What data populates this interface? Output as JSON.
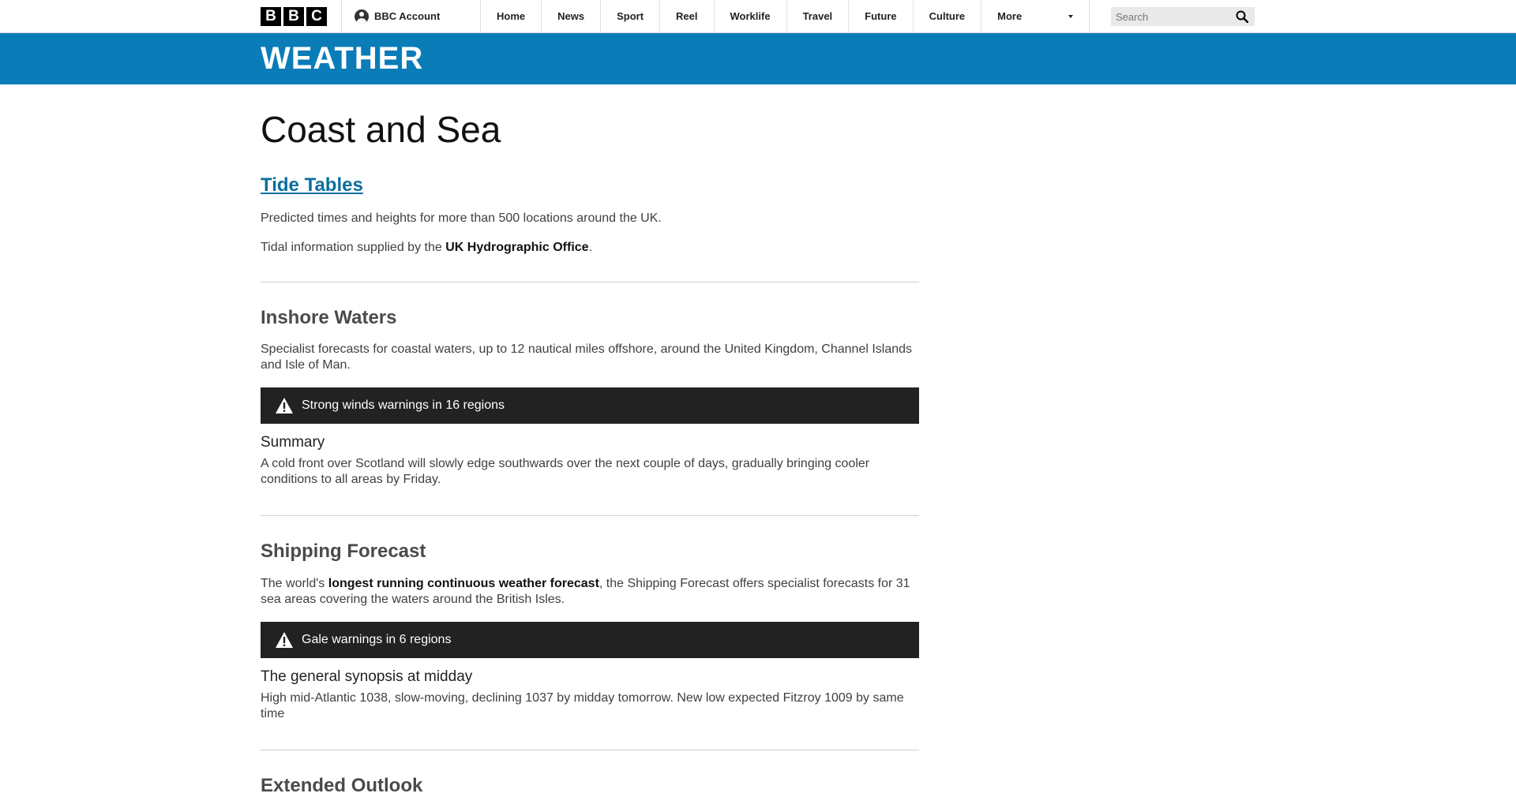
{
  "header": {
    "logo_letters": [
      "B",
      "B",
      "C"
    ],
    "account_label": "BBC Account",
    "nav": [
      "Home",
      "News",
      "Sport",
      "Reel",
      "Worklife",
      "Travel",
      "Future",
      "Culture"
    ],
    "more_label": "More",
    "search_placeholder": "Search"
  },
  "band": {
    "title": "WEATHER"
  },
  "page": {
    "title": "Coast and Sea"
  },
  "tide": {
    "title": "Tide Tables",
    "desc": "Predicted times and heights for more than 500 locations around the UK.",
    "supplied_prefix": "Tidal information supplied by the ",
    "supplier": "UK Hydrographic Office",
    "supplied_suffix": "."
  },
  "inshore": {
    "title": "Inshore Waters",
    "desc": "Specialist forecasts for coastal waters, up to 12 nautical miles offshore, around the United Kingdom, Channel Islands and Isle of Man.",
    "warning": "Strong winds warnings in 16 regions",
    "summary_label": "Summary",
    "summary": "A cold front over Scotland will slowly edge southwards over the next couple of days, gradually bringing cooler conditions to all areas by Friday."
  },
  "shipping": {
    "title": "Shipping Forecast",
    "desc_prefix": "The world's ",
    "desc_bold": "longest running continuous weather forecast",
    "desc_suffix": ", the Shipping Forecast offers specialist forecasts for 31 sea areas covering the waters around the British Isles.",
    "warning": "Gale warnings in 6 regions",
    "synopsis_label": "The general synopsis at midday",
    "synopsis": "High mid-Atlantic 1038, slow-moving, declining 1037 by midday tomorrow. New low expected Fitzroy 1009 by same time"
  },
  "extended": {
    "title": "Extended Outlook"
  },
  "colors": {
    "band": "#0a7cb8",
    "link": "#0a6e9e",
    "warning_bg": "#222222"
  }
}
